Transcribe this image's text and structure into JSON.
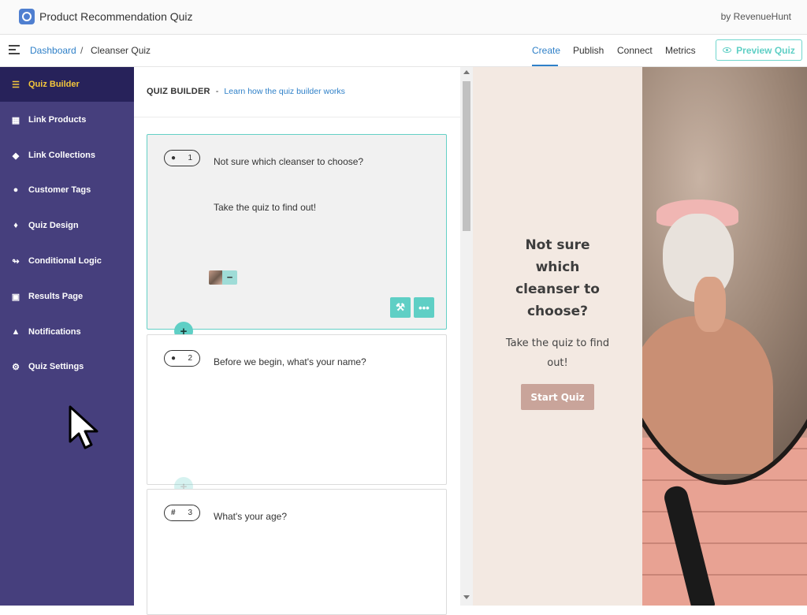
{
  "app": {
    "title": "Product Recommendation Quiz",
    "by": "by RevenueHunt",
    "logo_icon": "revenuehunt-logo-icon"
  },
  "breadcrumb": {
    "root": "Dashboard",
    "separator": "/",
    "current": "Cleanser Quiz"
  },
  "tabs": [
    {
      "label": "Create",
      "active": true
    },
    {
      "label": "Publish",
      "active": false
    },
    {
      "label": "Connect",
      "active": false
    },
    {
      "label": "Metrics",
      "active": false
    }
  ],
  "preview_button": {
    "label": "Preview Quiz",
    "icon": "eye-icon"
  },
  "sidebar": {
    "items": [
      {
        "label": "Quiz Builder",
        "icon": "list-icon",
        "active": true
      },
      {
        "label": "Link Products",
        "icon": "gift-icon",
        "active": false
      },
      {
        "label": "Link Collections",
        "icon": "tag-icon",
        "active": false
      },
      {
        "label": "Customer Tags",
        "icon": "user-icon",
        "active": false
      },
      {
        "label": "Quiz Design",
        "icon": "drop-icon",
        "active": false
      },
      {
        "label": "Conditional Logic",
        "icon": "branch-icon",
        "active": false
      },
      {
        "label": "Results Page",
        "icon": "cart-icon",
        "active": false
      },
      {
        "label": "Notifications",
        "icon": "bell-icon",
        "active": false
      },
      {
        "label": "Quiz Settings",
        "icon": "gear-icon",
        "active": false
      }
    ]
  },
  "builder": {
    "heading": "QUIZ BUILDER",
    "dash": "-",
    "help_link": "Learn how the quiz builder works",
    "questions": [
      {
        "number": "1",
        "icon": "speech-bubble-icon",
        "title": "Not sure which cleanser to choose?",
        "subtitle": "Take the quiz to find out!"
      },
      {
        "number": "2",
        "icon": "user-icon",
        "title": "Before we begin, what's your name?"
      },
      {
        "number": "3",
        "icon": "hash-icon",
        "title": "What's your age?"
      }
    ],
    "add_symbol": "+",
    "remove_symbol": "−",
    "settings_icon": "wrench-icon",
    "more_icon": "more-dots-icon"
  },
  "preview": {
    "title": "Not sure which cleanser to choose?",
    "subtitle": "Take the quiz to find out!",
    "button": "Start Quiz"
  },
  "colors": {
    "sidebar_bg": "#463f7d",
    "sidebar_active_bg": "#27225a",
    "sidebar_active_text": "#f4c73b",
    "accent_teal": "#5fcfc5",
    "link_blue": "#2f80c8",
    "preview_bg": "#f3e9e2",
    "start_button": "#c9a49a"
  }
}
